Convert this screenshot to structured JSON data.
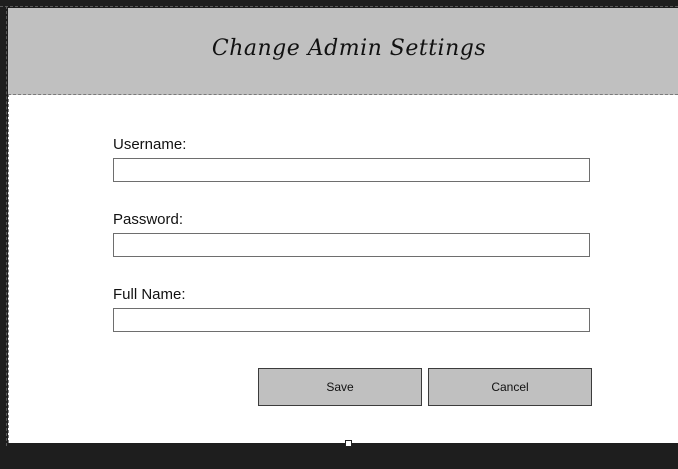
{
  "form": {
    "title": "Change Admin Settings",
    "fields": [
      {
        "label": "Username:",
        "value": ""
      },
      {
        "label": "Password:",
        "value": ""
      },
      {
        "label": "Full Name:",
        "value": ""
      }
    ],
    "buttons": {
      "save": "Save",
      "cancel": "Cancel"
    }
  }
}
